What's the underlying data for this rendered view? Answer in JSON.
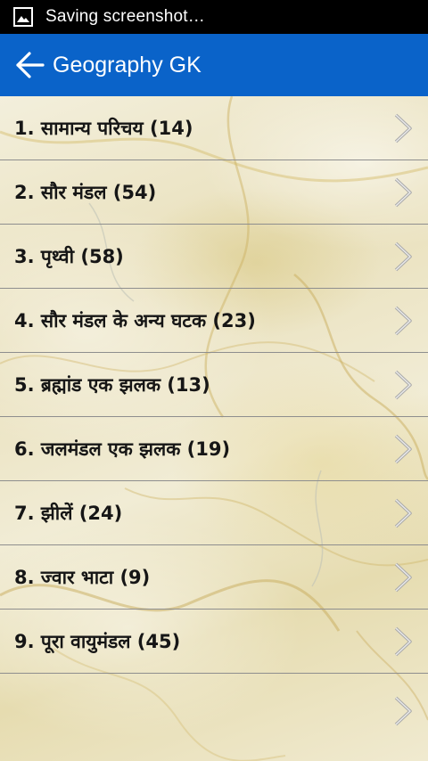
{
  "status_bar": {
    "notification_icon": "image-icon",
    "text": "Saving screenshot…"
  },
  "action_bar": {
    "back_icon": "arrow-left-icon",
    "title": "Geography GK"
  },
  "list": {
    "items": [
      {
        "label": "1. सामान्य परिचय (14)"
      },
      {
        "label": "2. सौर मंडल  (54)"
      },
      {
        "label": "3. पृथ्वी (58)"
      },
      {
        "label": "4. सौर मंडल के अन्य घटक (23)"
      },
      {
        "label": "5. ब्रह्मांड एक झलक (13)"
      },
      {
        "label": "6. जलमंडल एक झलक (19)"
      },
      {
        "label": "7. झीलें (24)"
      },
      {
        "label": "8. ज्वार भाटा (9)"
      },
      {
        "label": "9. पूरा वायुमंडल (45)"
      }
    ]
  },
  "colors": {
    "status_bar": "#000000",
    "action_bar": "#0a63c9",
    "divider": "#8e8e8e",
    "text": "#161616",
    "chevron": "#a9a9a9"
  }
}
